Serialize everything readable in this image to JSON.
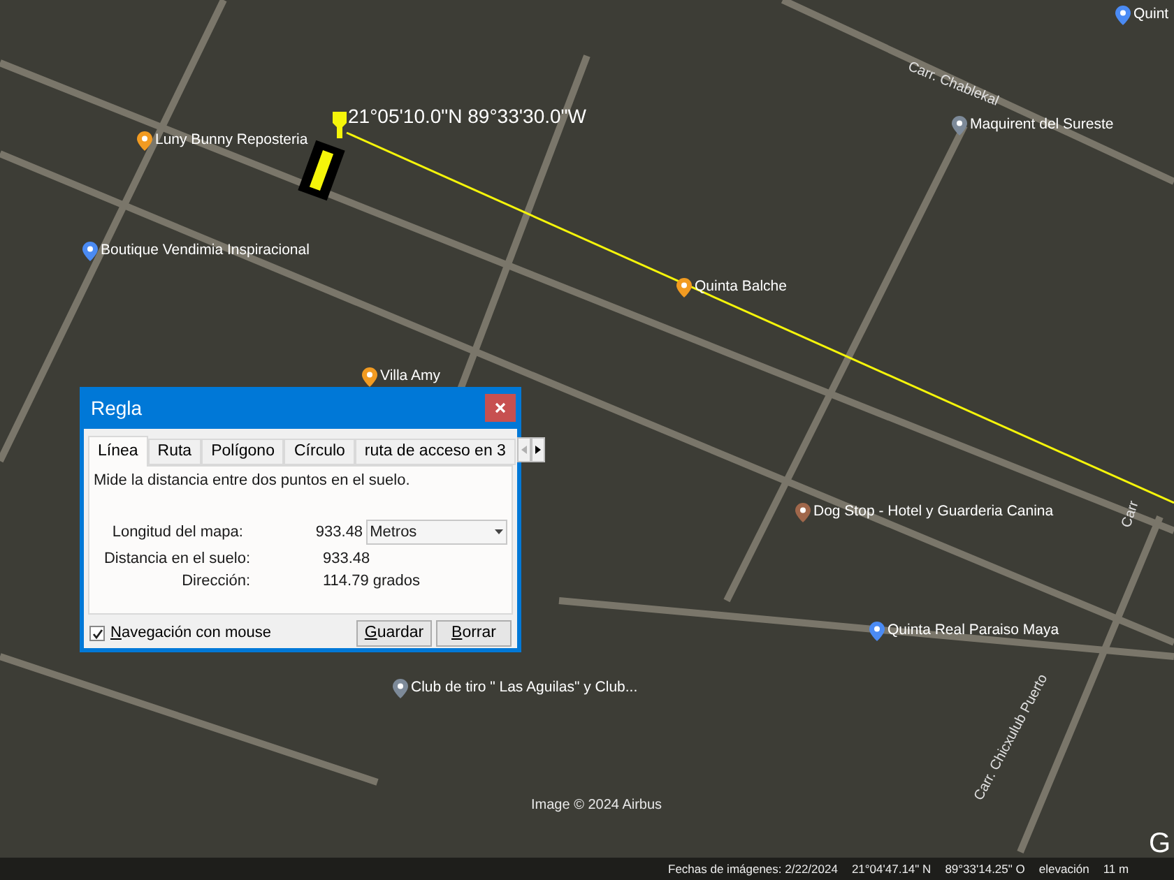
{
  "map": {
    "coordinate_label": "21°05'10.0\"N 89°33'30.0\"W",
    "places": [
      {
        "name": "Luny Bunny Reposteria",
        "color": "#f29b21"
      },
      {
        "name": "Boutique Vendimia Inspiracional",
        "color": "#4b8bf4"
      },
      {
        "name": "Villa Amy",
        "color": "#f29b21"
      },
      {
        "name": "Quinta Balche",
        "color": "#f29b21"
      },
      {
        "name": "Maquirent del Sureste",
        "color": "#7d8a99"
      },
      {
        "name": "Dog Stop - Hotel y Guarderia Canina",
        "color": "#a0674b"
      },
      {
        "name": "Quinta Real Paraiso Maya",
        "color": "#4b8bf4"
      },
      {
        "name": "Club de tiro \" Las Aguilas\" y Club...",
        "color": "#7d8a99"
      },
      {
        "name": "Quint",
        "color": "#4b8bf4"
      }
    ],
    "road_labels": [
      "Carr. Chablekal",
      "Carr. Chicxulub Puerto",
      "Carr"
    ],
    "attribution": "Image © 2024 Airbus",
    "logo": "G"
  },
  "dialog": {
    "title": "Regla",
    "tabs": [
      {
        "label": "Línea",
        "selected": true
      },
      {
        "label": "Ruta",
        "selected": false
      },
      {
        "label": "Polígono",
        "selected": false
      },
      {
        "label": "Círculo",
        "selected": false
      },
      {
        "label": "ruta de acceso en 3",
        "selected": false
      }
    ],
    "description": "Mide la distancia entre dos puntos en el suelo.",
    "fields": [
      {
        "label": "Longitud del mapa:",
        "value": "933.48",
        "unit_select": "Metros"
      },
      {
        "label": "Distancia en el suelo:",
        "value": "933.48"
      },
      {
        "label": "Dirección:",
        "value": "114.79 grados"
      }
    ],
    "mouse_navigation": {
      "label": "Navegación con mouse",
      "checked": true
    },
    "buttons": [
      "Guardar",
      "Borrar"
    ]
  },
  "status_bar": {
    "imagery_date": "Fechas de imágenes: 2/22/2024",
    "latitude": "21°04'47.14\" N",
    "longitude": "89°33'14.25\" O",
    "elevation_label": "elevación",
    "elevation_value": "11 m"
  }
}
